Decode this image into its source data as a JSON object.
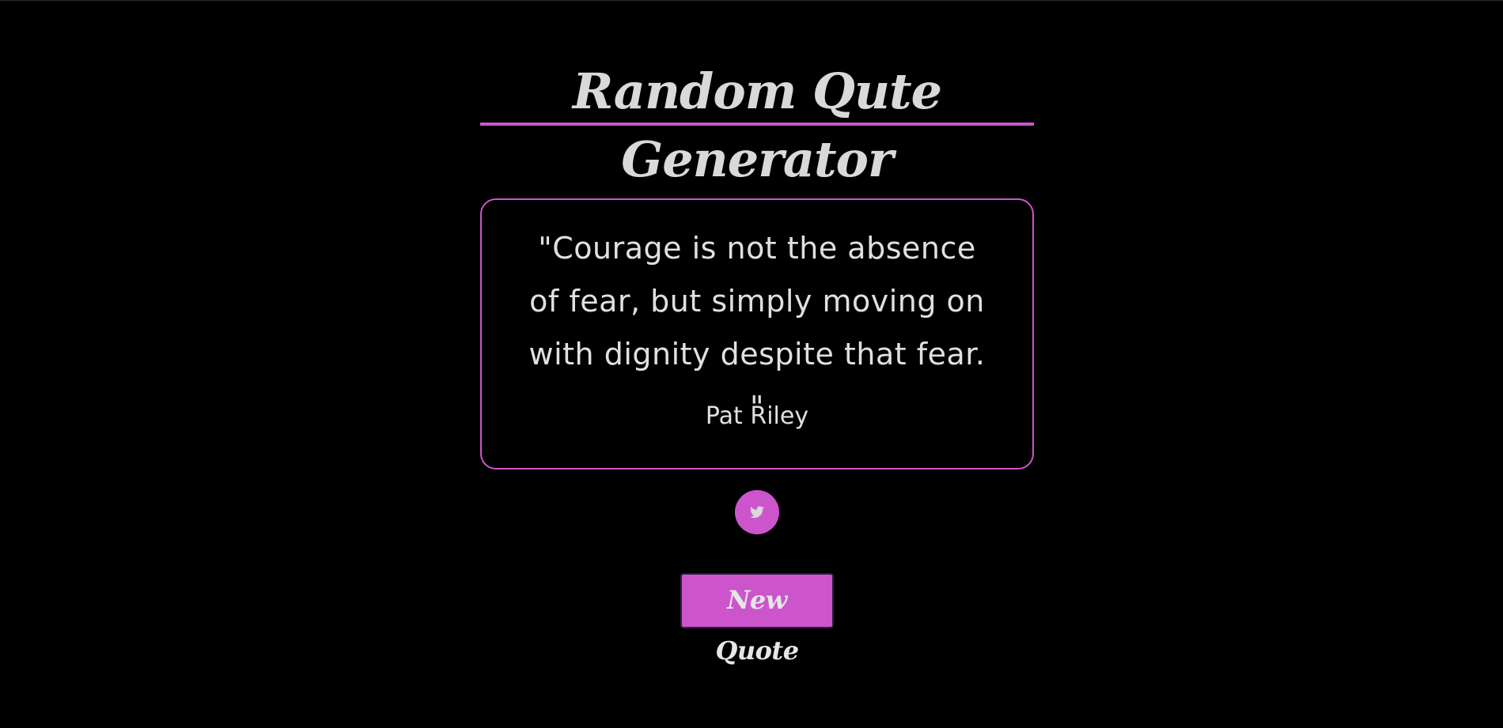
{
  "header": {
    "title": "Random Qute Generator"
  },
  "quote": {
    "text": "\"Courage is not the absence of fear, but simply moving on with dignity despite that fear. \"",
    "author": "Pat Riley"
  },
  "actions": {
    "tweet_icon": "twitter-bird-icon",
    "new_quote_label": "New Quote"
  },
  "colors": {
    "background": "#000000",
    "accent": "#cc55cc",
    "text": "#e0e0e0",
    "title_text": "#d9d9d9",
    "button_border": "#2a2040"
  }
}
